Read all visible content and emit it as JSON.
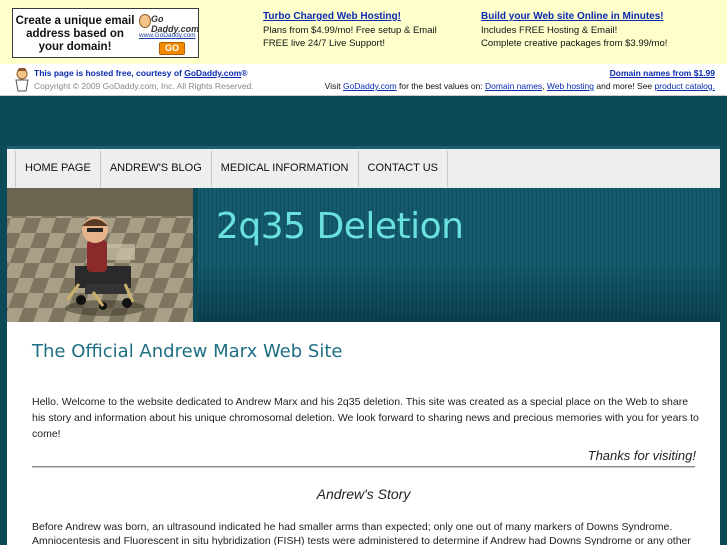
{
  "ad": {
    "banner_text": "Create a unique email address based on your domain!",
    "logo_word": "Go Daddy.com",
    "logo_url": "www.GoDaddy.com",
    "go_label": "GO",
    "promos": [
      {
        "title": "Turbo Charged Web Hosting!",
        "lines": [
          "Plans from $4.99/mo! Free setup & Email",
          "FREE live 24/7 Live Support!"
        ]
      },
      {
        "title": "Build your Web site Online in Minutes!",
        "lines": [
          "Includes FREE Hosting & Email!",
          "Complete creative packages from $3.99/mo!"
        ]
      }
    ]
  },
  "hosted": {
    "line1_prefix": "This page is hosted free, courtesy of ",
    "line1_link": "GoDaddy.com",
    "line1_suffix": "®",
    "copyright": "Copyright © 2009 GoDaddy.com, Inc. All Rights Reserved.",
    "right_link": "Domain names from $1.99",
    "right2_prefix": "Visit ",
    "right2_link1": "GoDaddy.com",
    "right2_mid": " for the best values on: ",
    "right2_link2": "Domain names",
    "right2_sep": ", ",
    "right2_link3": "Web hosting",
    "right2_mid2": " and more! See ",
    "right2_link4": "product catalog."
  },
  "nav": {
    "items": [
      {
        "label": "HOME PAGE"
      },
      {
        "label": "ANDREW'S BLOG"
      },
      {
        "label": "MEDICAL INFORMATION"
      },
      {
        "label": "CONTACT US"
      }
    ]
  },
  "header": {
    "site_title": "2q35 Deletion"
  },
  "content": {
    "heading": "The Official Andrew Marx Web Site",
    "welcome": "Hello. Welcome to the website dedicated to Andrew Marx and his 2q35 deletion.  This site was created as a special place on the Web to share his story and information about his unique chromosomal deletion.  We look forward to sharing news and precious memories with you for years to come!",
    "thanks": "Thanks for visiting!",
    "story_heading": "Andrew's Story",
    "story_text": "Before Andrew was born, an ultrasound indicated he had smaller arms than expected; only one out of many markers of Downs Syndrome. Amniocentesis and Fluorescent in situ hybridization (FISH) tests were administered to determine if Andrew had Downs Syndrome or any other"
  }
}
